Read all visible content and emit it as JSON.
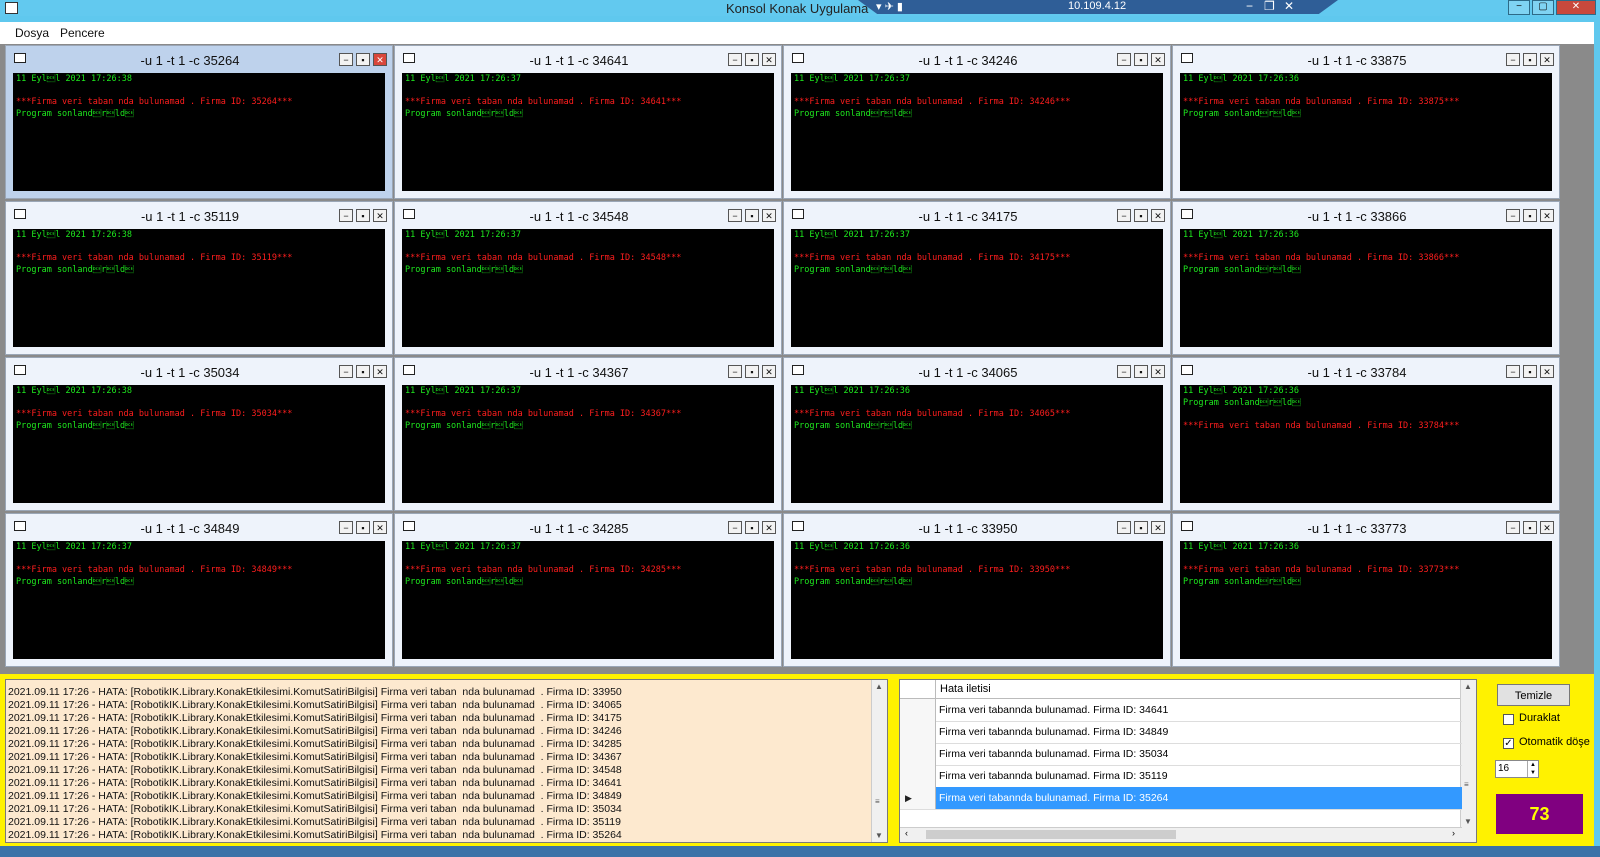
{
  "window": {
    "title": "Konsol Konak Uygulama",
    "rdp_ip": "10.109.4.12"
  },
  "menu": [
    "Dosya",
    "Pencere"
  ],
  "children": [
    {
      "title": "-u 1 -t 1 -c 35264",
      "lines": [
        {
          "t": "11 Eyl\u0013l 2021 17:26:38",
          "c": "g"
        },
        {
          "t": "",
          "c": "g"
        },
        {
          "t": "***Firma veri taban nda bulunamad . Firma ID: 35264***",
          "c": "r"
        },
        {
          "t": "Program sonland\u0013r\u0013ld\u0013",
          "c": "g"
        }
      ]
    },
    {
      "title": "-u 1 -t 1 -c 34641",
      "lines": [
        {
          "t": "11 Eyl\u0013l 2021 17:26:37",
          "c": "g"
        },
        {
          "t": "",
          "c": "g"
        },
        {
          "t": "***Firma veri taban nda bulunamad . Firma ID: 34641***",
          "c": "r"
        },
        {
          "t": "Program sonland\u0013r\u0013ld\u0013",
          "c": "g"
        }
      ]
    },
    {
      "title": "-u 1 -t 1 -c 34246",
      "lines": [
        {
          "t": "11 Eyl\u0013l 2021 17:26:37",
          "c": "g"
        },
        {
          "t": "",
          "c": "g"
        },
        {
          "t": "***Firma veri taban nda bulunamad . Firma ID: 34246***",
          "c": "r"
        },
        {
          "t": "Program sonland\u0013r\u0013ld\u0013",
          "c": "g"
        }
      ]
    },
    {
      "title": "-u 1 -t 1 -c 33875",
      "lines": [
        {
          "t": "11 Eyl\u0013l 2021 17:26:36",
          "c": "g"
        },
        {
          "t": "",
          "c": "g"
        },
        {
          "t": "***Firma veri taban nda bulunamad . Firma ID: 33875***",
          "c": "r"
        },
        {
          "t": "Program sonland\u0013r\u0013ld\u0013",
          "c": "g"
        }
      ]
    },
    {
      "title": "-u 1 -t 1 -c 35119",
      "lines": [
        {
          "t": "11 Eyl\u0013l 2021 17:26:38",
          "c": "g"
        },
        {
          "t": "",
          "c": "g"
        },
        {
          "t": "***Firma veri taban nda bulunamad . Firma ID: 35119***",
          "c": "r"
        },
        {
          "t": "Program sonland\u0013r\u0013ld\u0013",
          "c": "g"
        }
      ]
    },
    {
      "title": "-u 1 -t 1 -c 34548",
      "lines": [
        {
          "t": "11 Eyl\u0013l 2021 17:26:37",
          "c": "g"
        },
        {
          "t": "",
          "c": "g"
        },
        {
          "t": "***Firma veri taban nda bulunamad . Firma ID: 34548***",
          "c": "r"
        },
        {
          "t": "Program sonland\u0013r\u0013ld\u0013",
          "c": "g"
        }
      ]
    },
    {
      "title": "-u 1 -t 1 -c 34175",
      "lines": [
        {
          "t": "11 Eyl\u0013l 2021 17:26:37",
          "c": "g"
        },
        {
          "t": "",
          "c": "g"
        },
        {
          "t": "***Firma veri taban nda bulunamad . Firma ID: 34175***",
          "c": "r"
        },
        {
          "t": "Program sonland\u0013r\u0013ld\u0013",
          "c": "g"
        }
      ]
    },
    {
      "title": "-u 1 -t 1 -c 33866",
      "lines": [
        {
          "t": "11 Eyl\u0013l 2021 17:26:36",
          "c": "g"
        },
        {
          "t": "",
          "c": "g"
        },
        {
          "t": "***Firma veri taban nda bulunamad . Firma ID: 33866***",
          "c": "r"
        },
        {
          "t": "Program sonland\u0013r\u0013ld\u0013",
          "c": "g"
        }
      ]
    },
    {
      "title": "-u 1 -t 1 -c 35034",
      "lines": [
        {
          "t": "11 Eyl\u0013l 2021 17:26:38",
          "c": "g"
        },
        {
          "t": "",
          "c": "g"
        },
        {
          "t": "***Firma veri taban nda bulunamad . Firma ID: 35034***",
          "c": "r"
        },
        {
          "t": "Program sonland\u0013r\u0013ld\u0013",
          "c": "g"
        }
      ]
    },
    {
      "title": "-u 1 -t 1 -c 34367",
      "lines": [
        {
          "t": "11 Eyl\u0013l 2021 17:26:37",
          "c": "g"
        },
        {
          "t": "",
          "c": "g"
        },
        {
          "t": "***Firma veri taban nda bulunamad . Firma ID: 34367***",
          "c": "r"
        },
        {
          "t": "Program sonland\u0013r\u0013ld\u0013",
          "c": "g"
        }
      ]
    },
    {
      "title": "-u 1 -t 1 -c 34065",
      "lines": [
        {
          "t": "11 Eyl\u0013l 2021 17:26:36",
          "c": "g"
        },
        {
          "t": "",
          "c": "g"
        },
        {
          "t": "***Firma veri taban nda bulunamad . Firma ID: 34065***",
          "c": "r"
        },
        {
          "t": "Program sonland\u0013r\u0013ld\u0013",
          "c": "g"
        }
      ]
    },
    {
      "title": "-u 1 -t 1 -c 33784",
      "lines": [
        {
          "t": "11 Eyl\u0013l 2021 17:26:36",
          "c": "g"
        },
        {
          "t": "Program sonland\u0013r\u0013ld\u0013",
          "c": "g"
        },
        {
          "t": "",
          "c": "g"
        },
        {
          "t": "***Firma veri taban nda bulunamad . Firma ID: 33784***",
          "c": "r"
        }
      ]
    },
    {
      "title": "-u 1 -t 1 -c 34849",
      "lines": [
        {
          "t": "11 Eyl\u0013l 2021 17:26:37",
          "c": "g"
        },
        {
          "t": "",
          "c": "g"
        },
        {
          "t": "***Firma veri taban nda bulunamad . Firma ID: 34849***",
          "c": "r"
        },
        {
          "t": "Program sonland\u0013r\u0013ld\u0013",
          "c": "g"
        }
      ]
    },
    {
      "title": "-u 1 -t 1 -c 34285",
      "lines": [
        {
          "t": "11 Eyl\u0013l 2021 17:26:37",
          "c": "g"
        },
        {
          "t": "",
          "c": "g"
        },
        {
          "t": "***Firma veri taban nda bulunamad . Firma ID: 34285***",
          "c": "r"
        },
        {
          "t": "Program sonland\u0013r\u0013ld\u0013",
          "c": "g"
        }
      ]
    },
    {
      "title": "-u 1 -t 1 -c 33950",
      "lines": [
        {
          "t": "11 Eyl\u0013l 2021 17:26:36",
          "c": "g"
        },
        {
          "t": "",
          "c": "g"
        },
        {
          "t": "***Firma veri taban nda bulunamad . Firma ID: 33950***",
          "c": "r"
        },
        {
          "t": "Program sonland\u0013r\u0013ld\u0013",
          "c": "g"
        }
      ]
    },
    {
      "title": "-u 1 -t 1 -c 33773",
      "lines": [
        {
          "t": "11 Eyl\u0013l 2021 17:26:36",
          "c": "g"
        },
        {
          "t": "",
          "c": "g"
        },
        {
          "t": "***Firma veri taban nda bulunamad . Firma ID: 33773***",
          "c": "r"
        },
        {
          "t": "Program sonland\u0013r\u0013ld\u0013",
          "c": "g"
        }
      ]
    }
  ],
  "log_lines": [
    "2021.09.11 17:26 - HATA: [RobotikIK.Library.KonakEtkilesimi.KomutSatiriBilgisi] Firma veri taban  nda bulunamad  . Firma ID: 33950",
    "2021.09.11 17:26 - HATA: [RobotikIK.Library.KonakEtkilesimi.KomutSatiriBilgisi] Firma veri taban  nda bulunamad  . Firma ID: 34065",
    "2021.09.11 17:26 - HATA: [RobotikIK.Library.KonakEtkilesimi.KomutSatiriBilgisi] Firma veri taban  nda bulunamad  . Firma ID: 34175",
    "2021.09.11 17:26 - HATA: [RobotikIK.Library.KonakEtkilesimi.KomutSatiriBilgisi] Firma veri taban  nda bulunamad  . Firma ID: 34246",
    "2021.09.11 17:26 - HATA: [RobotikIK.Library.KonakEtkilesimi.KomutSatiriBilgisi] Firma veri taban  nda bulunamad  . Firma ID: 34285",
    "2021.09.11 17:26 - HATA: [RobotikIK.Library.KonakEtkilesimi.KomutSatiriBilgisi] Firma veri taban  nda bulunamad  . Firma ID: 34367",
    "2021.09.11 17:26 - HATA: [RobotikIK.Library.KonakEtkilesimi.KomutSatiriBilgisi] Firma veri taban  nda bulunamad  . Firma ID: 34548",
    "2021.09.11 17:26 - HATA: [RobotikIK.Library.KonakEtkilesimi.KomutSatiriBilgisi] Firma veri taban  nda bulunamad  . Firma ID: 34641",
    "2021.09.11 17:26 - HATA: [RobotikIK.Library.KonakEtkilesimi.KomutSatiriBilgisi] Firma veri taban  nda bulunamad  . Firma ID: 34849",
    "2021.09.11 17:26 - HATA: [RobotikIK.Library.KonakEtkilesimi.KomutSatiriBilgisi] Firma veri taban  nda bulunamad  . Firma ID: 35034",
    "2021.09.11 17:26 - HATA: [RobotikIK.Library.KonakEtkilesimi.KomutSatiriBilgisi] Firma veri taban  nda bulunamad  . Firma ID: 35119",
    "2021.09.11 17:26 - HATA: [RobotikIK.Library.KonakEtkilesimi.KomutSatiriBilgisi] Firma veri taban  nda bulunamad  . Firma ID: 35264"
  ],
  "grid": {
    "header": "Hata iletisi",
    "rows": [
      "Firma veri tabannda bulunamad. Firma ID: 34641",
      "Firma veri tabannda bulunamad. Firma ID: 34849",
      "Firma veri tabannda bulunamad. Firma ID: 35034",
      "Firma veri tabannda bulunamad. Firma ID: 35119",
      "Firma veri tabannda bulunamad. Firma ID: 35264"
    ]
  },
  "side": {
    "clear_label": "Temizle",
    "pause_label": "Duraklat",
    "pause_checked": false,
    "autotile_label": "Otomatik döşe",
    "autotile_checked": true,
    "count_value": "16",
    "counter": "73"
  },
  "colors": {
    "console_ok": "#1ee81e",
    "console_err": "#ff1e1e",
    "bottom_panel": "#fff200",
    "counter_bg": "#800080",
    "counter_fg": "#ffff00",
    "selected_row": "#3399ff"
  },
  "icons": [
    "app-window-icon",
    "pin-icon",
    "signal-icon",
    "minimize-icon",
    "maximize-icon",
    "close-icon",
    "row-pointer-icon",
    "scroll-up-icon",
    "scroll-down-icon"
  ]
}
